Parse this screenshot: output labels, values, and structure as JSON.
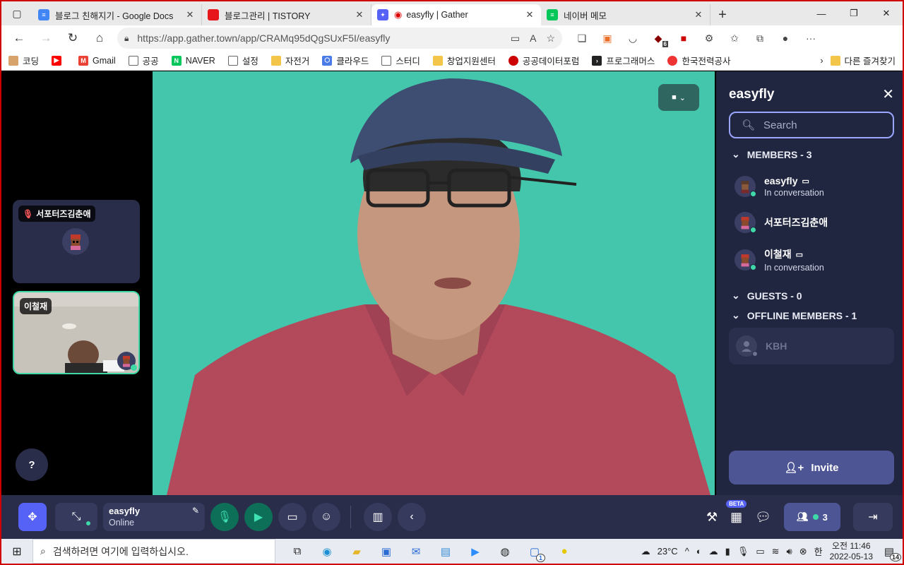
{
  "browser": {
    "tabs": [
      {
        "title": "블로그 친해지기 - Google Docs",
        "color": "#4285f4"
      },
      {
        "title": "블로그관리 | TISTORY",
        "color": "#e6161b"
      },
      {
        "title": "easyfly | Gather",
        "color": "#5662f6",
        "active": true
      },
      {
        "title": "네이버 메모",
        "color": "#03c75a"
      }
    ],
    "url": "https://app.gather.town/app/CRAMq95dQgSUxF5I/easyfly",
    "bookmarks": [
      "코딩",
      "",
      "Gmail",
      "공공",
      "NAVER",
      "설정",
      "자전거",
      "클라우드",
      "스터디",
      "창업지원센터",
      "공공데이터포럼",
      "프로그래머스",
      "한국전력공사"
    ],
    "bookmarks_other": "다른 즐겨찾기",
    "ext_badge": "6"
  },
  "left_tiles": [
    {
      "name": "서포터즈김춘애",
      "muted": true
    },
    {
      "name": "이철재"
    }
  ],
  "help_label": "?",
  "panel": {
    "title": "easyfly",
    "search_placeholder": "Search",
    "members_header": "MEMBERS - 3",
    "members": [
      {
        "name": "easyfly",
        "status": "In conversation",
        "chat": true
      },
      {
        "name": "서포터즈김춘애",
        "status": "",
        "chat": false
      },
      {
        "name": "이철재",
        "status": "In conversation",
        "chat": true
      }
    ],
    "guests_header": "GUESTS - 0",
    "offline_header": "OFFLINE MEMBERS - 1",
    "offline_members": [
      {
        "name": "KBH"
      }
    ],
    "invite_label": "Invite"
  },
  "toolbar": {
    "user_name": "easyfly",
    "user_status": "Online",
    "beta_label": "BETA",
    "member_count": "3"
  },
  "taskbar": {
    "search_placeholder": "검색하려면 여기에 입력하십시오.",
    "temperature": "23°C",
    "ime": "한",
    "time": "오전 11:46",
    "date": "2022-05-13",
    "notifications": "14",
    "app_badge": "1"
  }
}
